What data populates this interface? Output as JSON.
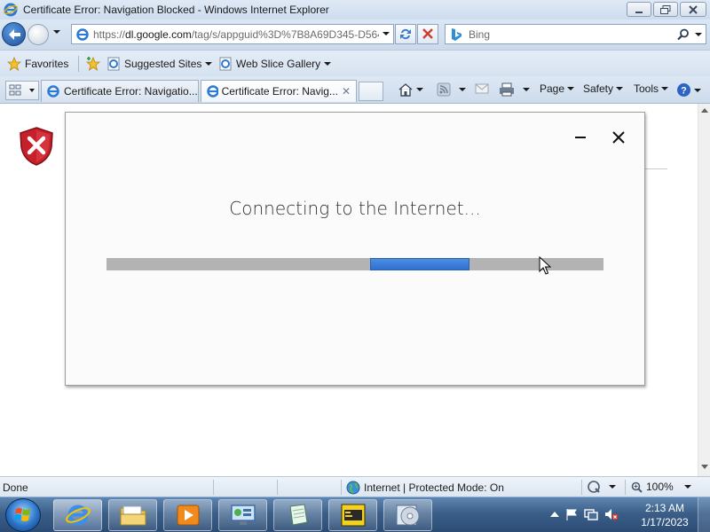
{
  "window": {
    "title": "Certificate Error: Navigation Blocked - Windows Internet Explorer"
  },
  "address_bar": {
    "url_prefix": "https://",
    "url_host": "dl.google.com",
    "url_path": "/tag/s/appguid%3D%7B8A69D345-D564"
  },
  "search": {
    "placeholder": "Bing"
  },
  "favorites_bar": {
    "favorites_label": "Favorites",
    "suggested_sites": "Suggested Sites",
    "web_slice_gallery": "Web Slice Gallery"
  },
  "tabs": [
    {
      "label": "Certificate Error: Navigatio..."
    },
    {
      "label": "Certificate Error: Navig..."
    }
  ],
  "command_bar": {
    "page": "Page",
    "safety": "Safety",
    "tools": "Tools"
  },
  "dialog": {
    "message": "Connecting to the Internet...",
    "progress_start": 0.53,
    "progress_end": 0.73
  },
  "status_bar": {
    "status": "Done",
    "zone": "Internet | Protected Mode: On",
    "zoom": "100%"
  },
  "taskbar": {
    "time": "2:13 AM",
    "date": "1/17/2023"
  }
}
